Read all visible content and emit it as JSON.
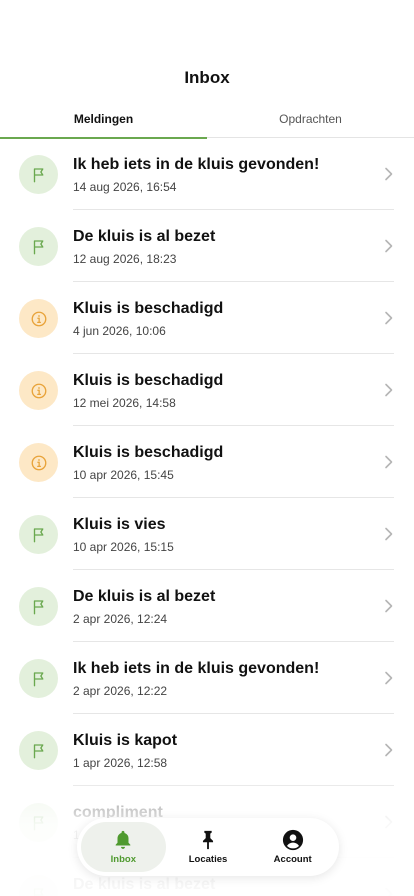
{
  "header": {
    "title": "Inbox"
  },
  "tabs": [
    {
      "label": "Meldingen",
      "active": true
    },
    {
      "label": "Opdrachten",
      "active": false
    }
  ],
  "notifications": [
    {
      "title": "Ik heb iets in de kluis gevonden!",
      "date": "14 aug 2026, 16:54",
      "icon": "flag-icon",
      "color": "green"
    },
    {
      "title": "De kluis is al bezet",
      "date": "12 aug 2026, 18:23",
      "icon": "flag-icon",
      "color": "green"
    },
    {
      "title": "Kluis is beschadigd",
      "date": "4 jun 2026, 10:06",
      "icon": "info-icon",
      "color": "orange"
    },
    {
      "title": "Kluis is beschadigd",
      "date": "12 mei 2026, 14:58",
      "icon": "info-icon",
      "color": "orange"
    },
    {
      "title": "Kluis is beschadigd",
      "date": "10 apr 2026, 15:45",
      "icon": "info-icon",
      "color": "orange"
    },
    {
      "title": "Kluis is vies",
      "date": "10 apr 2026, 15:15",
      "icon": "flag-icon",
      "color": "green"
    },
    {
      "title": "De kluis is al bezet",
      "date": "2 apr 2026, 12:24",
      "icon": "flag-icon",
      "color": "green"
    },
    {
      "title": "Ik heb iets in de kluis gevonden!",
      "date": "2 apr 2026, 12:22",
      "icon": "flag-icon",
      "color": "green"
    },
    {
      "title": "Kluis is kapot",
      "date": "1 apr 2026, 12:58",
      "icon": "flag-icon",
      "color": "green"
    },
    {
      "title": "compliment",
      "date": "1",
      "icon": "flag-icon",
      "color": "green"
    },
    {
      "title": "De kluis is al bezet",
      "date": "",
      "icon": "flag-icon",
      "color": "green"
    }
  ],
  "nav": [
    {
      "label": "Inbox",
      "icon": "bell-icon",
      "active": true
    },
    {
      "label": "Locaties",
      "icon": "pin-icon",
      "active": false
    },
    {
      "label": "Account",
      "icon": "account-icon",
      "active": false
    }
  ],
  "colors": {
    "accent": "#6aa84f",
    "flag_green": "#6aa84f",
    "info_orange": "#e8a33a",
    "green_bg": "#e3f0dc",
    "orange_bg": "#fde8c6"
  }
}
